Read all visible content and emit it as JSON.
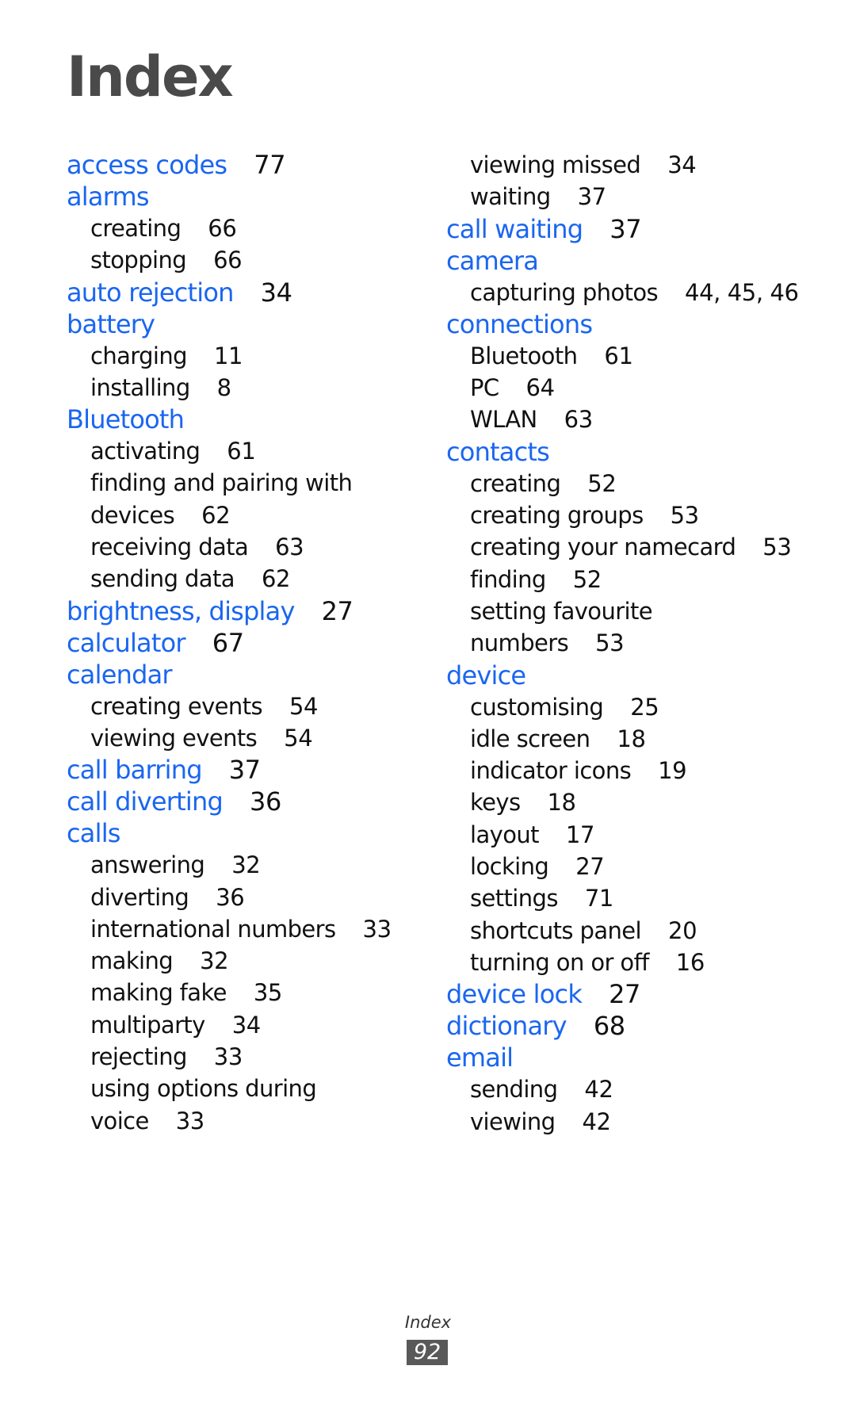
{
  "page": {
    "title": "Index",
    "footer_label": "Index",
    "page_number": "92",
    "colors": {
      "heading": "#1a66f0",
      "body": "#111111",
      "title": "#4a4a4a",
      "page_badge": "#595959"
    }
  },
  "left_column": [
    {
      "term": "access codes",
      "pages": "77",
      "subs": []
    },
    {
      "term": "alarms",
      "pages": "",
      "subs": [
        {
          "text": "creating",
          "pages": "66"
        },
        {
          "text": "stopping",
          "pages": "66"
        }
      ]
    },
    {
      "term": "auto rejection",
      "pages": "34",
      "subs": []
    },
    {
      "term": "battery",
      "pages": "",
      "subs": [
        {
          "text": "charging",
          "pages": "11"
        },
        {
          "text": "installing",
          "pages": "8"
        }
      ]
    },
    {
      "term": "Bluetooth",
      "pages": "",
      "subs": [
        {
          "text": "activating",
          "pages": "61"
        },
        {
          "text": "finding and pairing with devices",
          "pages": "62",
          "wrap": [
            "finding and pairing with",
            "devices"
          ]
        },
        {
          "text": "receiving data",
          "pages": "63"
        },
        {
          "text": "sending data",
          "pages": "62"
        }
      ]
    },
    {
      "term": "brightness, display",
      "pages": "27",
      "subs": []
    },
    {
      "term": "calculator",
      "pages": "67",
      "subs": []
    },
    {
      "term": "calendar",
      "pages": "",
      "subs": [
        {
          "text": "creating events",
          "pages": "54"
        },
        {
          "text": "viewing events",
          "pages": "54"
        }
      ]
    },
    {
      "term": "call barring",
      "pages": "37",
      "subs": []
    },
    {
      "term": "call diverting",
      "pages": "36",
      "subs": []
    },
    {
      "term": "calls",
      "pages": "",
      "subs": [
        {
          "text": "answering",
          "pages": "32"
        },
        {
          "text": "diverting",
          "pages": "36"
        },
        {
          "text": "international numbers",
          "pages": "33"
        },
        {
          "text": "making",
          "pages": "32"
        },
        {
          "text": "making fake",
          "pages": "35"
        },
        {
          "text": "multiparty",
          "pages": "34"
        },
        {
          "text": "rejecting",
          "pages": "33"
        },
        {
          "text": "using options during voice",
          "pages": "33",
          "wrap": [
            "using options during",
            "voice"
          ]
        }
      ]
    }
  ],
  "right_column": [
    {
      "term": "",
      "continued": true,
      "subs": [
        {
          "text": "viewing missed",
          "pages": "34"
        },
        {
          "text": "waiting",
          "pages": "37"
        }
      ]
    },
    {
      "term": "call waiting",
      "pages": "37",
      "subs": []
    },
    {
      "term": "camera",
      "pages": "",
      "subs": [
        {
          "text": "capturing photos",
          "pages": "44, 45, 46"
        }
      ]
    },
    {
      "term": "connections",
      "pages": "",
      "subs": [
        {
          "text": "Bluetooth",
          "pages": "61"
        },
        {
          "text": "PC",
          "pages": "64"
        },
        {
          "text": "WLAN",
          "pages": "63"
        }
      ]
    },
    {
      "term": "contacts",
      "pages": "",
      "subs": [
        {
          "text": "creating",
          "pages": "52"
        },
        {
          "text": "creating groups",
          "pages": "53"
        },
        {
          "text": "creating your namecard",
          "pages": "53"
        },
        {
          "text": "finding",
          "pages": "52"
        },
        {
          "text": "setting favourite numbers",
          "pages": "53",
          "wrap": [
            "setting favourite",
            "numbers"
          ]
        }
      ]
    },
    {
      "term": "device",
      "pages": "",
      "subs": [
        {
          "text": "customising",
          "pages": "25"
        },
        {
          "text": "idle screen",
          "pages": "18"
        },
        {
          "text": "indicator icons",
          "pages": "19"
        },
        {
          "text": "keys",
          "pages": "18"
        },
        {
          "text": "layout",
          "pages": "17"
        },
        {
          "text": "locking",
          "pages": "27"
        },
        {
          "text": "settings",
          "pages": "71"
        },
        {
          "text": "shortcuts panel",
          "pages": "20"
        },
        {
          "text": "turning on or off",
          "pages": "16"
        }
      ]
    },
    {
      "term": "device lock",
      "pages": "27",
      "subs": []
    },
    {
      "term": "dictionary",
      "pages": "68",
      "subs": []
    },
    {
      "term": "email",
      "pages": "",
      "subs": [
        {
          "text": "sending",
          "pages": "42"
        },
        {
          "text": "viewing",
          "pages": "42"
        }
      ]
    }
  ]
}
